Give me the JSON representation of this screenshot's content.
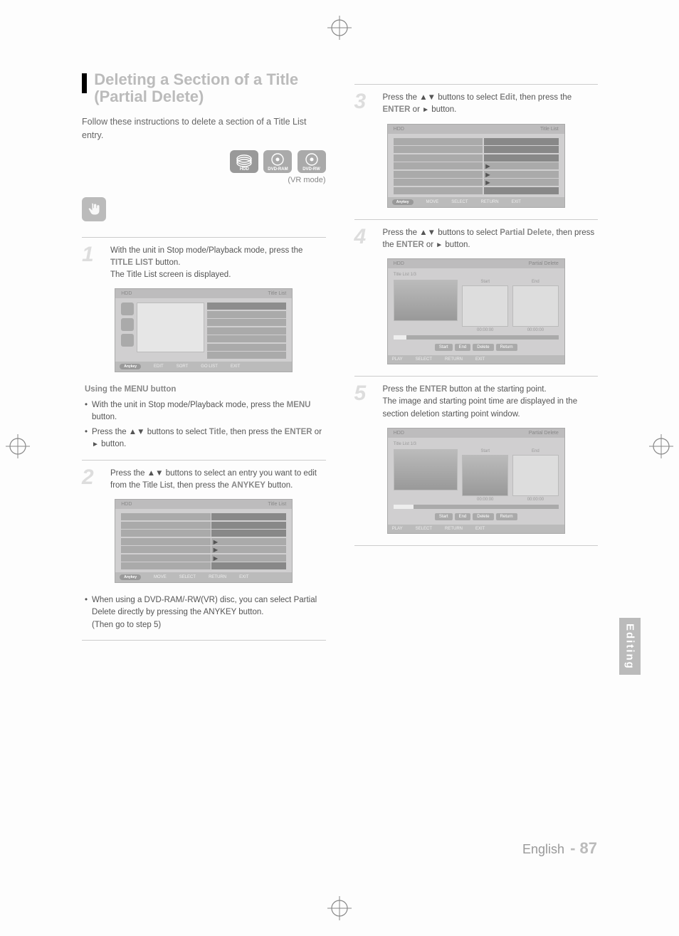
{
  "section_title": "Deleting a Section of a Title (Partial Delete)",
  "intro": "Follow these instructions to delete a section of a Title List entry.",
  "vr_mode": "(VR mode)",
  "disc_labels": {
    "hdd": "HDD",
    "ram": "DVD-RAM",
    "rw": "DVD-RW"
  },
  "using_menu": "Using the MENU button",
  "step1": {
    "num": "1",
    "line1_a": "With the unit in Stop mode/Playback mode, press the ",
    "line1_b": "TITLE LIST",
    "line1_c": " button.",
    "line2": "The Title List screen is displayed."
  },
  "ui1": {
    "header_left": "HDD",
    "header_right": "Title List",
    "footer_anykey": "Anykey",
    "footer_edit": "EDIT",
    "footer_sort": "SORT",
    "footer_golist": "GO LIST",
    "footer_exit": "EXIT"
  },
  "using_menu_block": {
    "b1a": "With the unit in Stop mode/Playback mode, press the ",
    "b1b": "MENU",
    "b1c": " button.",
    "b2a": "Press the ▲▼ buttons to select ",
    "b2b": "Title",
    "b2c": ", then press the ",
    "b2d": "ENTER",
    "b2e": " or ",
    "b2f": "►",
    "b2g": " button."
  },
  "step2": {
    "num": "2",
    "a": "Press the ▲▼ buttons to select an entry you want to edit from the Title List, then press the ",
    "b": "ANYKEY",
    "c": " button."
  },
  "ui2": {
    "header_left": "HDD",
    "header_right": "Title List",
    "footer_move": "MOVE",
    "footer_select": "SELECT",
    "footer_return": "RETURN",
    "footer_exit": "EXIT"
  },
  "note2": {
    "l1": "When using a DVD-RAM/-RW(VR) disc, you can select Partial Delete directly by pressing the ANYKEY button.",
    "l2": "(Then go to step 5)"
  },
  "step3": {
    "num": "3",
    "a": "Press the ▲▼ buttons to select ",
    "b": "Edit",
    "c": ", then press the ",
    "d": "ENTER",
    "e": " or ",
    "f": "►",
    "g": " button."
  },
  "step4": {
    "num": "4",
    "a": "Press the ▲▼ buttons to select ",
    "b": "Partial Delete",
    "c": ", then press the ",
    "d": "ENTER",
    "e": " or ",
    "f": "►",
    "g": " button."
  },
  "ui_edit": {
    "header_left": "HDD",
    "header_right": "Partial Delete",
    "title_no": "Title List  1/3",
    "start_lbl": "Start",
    "end_lbl": "End",
    "time_zero": "00:00:00",
    "btn_start": "Start",
    "btn_end": "End",
    "btn_delete": "Delete",
    "btn_return": "Return",
    "footer_play": "PLAY",
    "footer_select": "SELECT",
    "footer_return": "RETURN",
    "footer_exit": "EXIT"
  },
  "step5": {
    "num": "5",
    "a": "Press the ",
    "b": "ENTER",
    "c": " button at the starting point.",
    "d": "The image and starting point time are displayed in the section deletion starting point window."
  },
  "right_tab": "Editing",
  "footer_lang": "English",
  "footer_page": "- 87"
}
